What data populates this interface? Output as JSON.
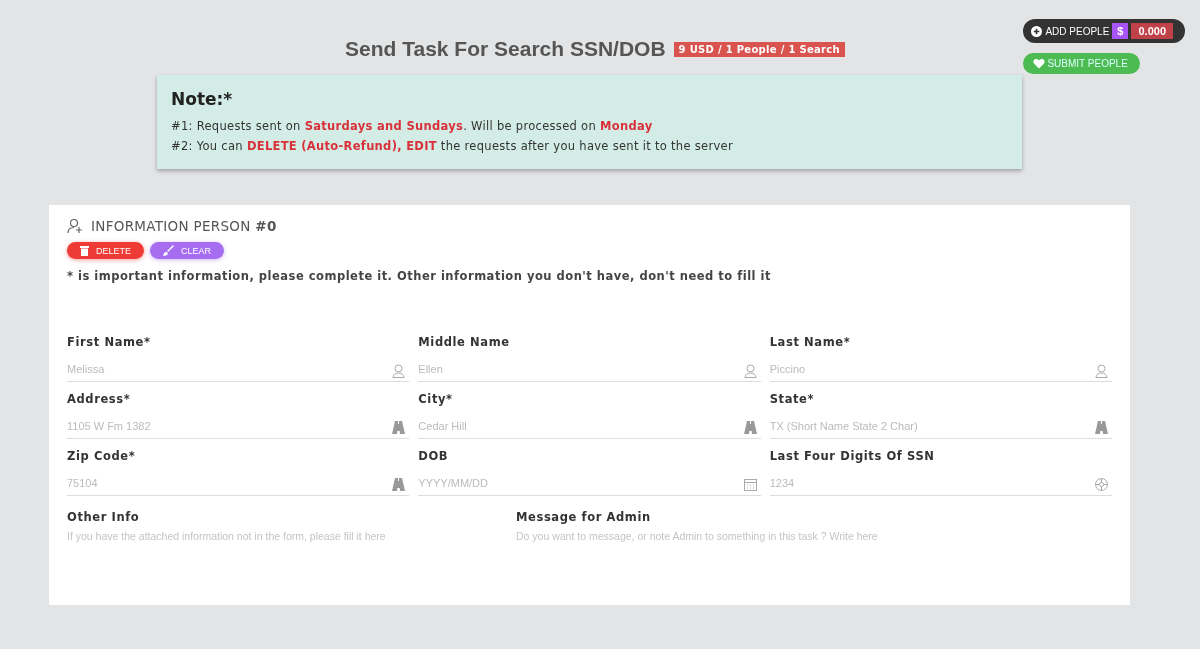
{
  "header": {
    "title": "Send Task For Search SSN/DOB",
    "price_badge": "9 USD / 1 People / 1 Search"
  },
  "actions": {
    "add_people": "ADD PEOPLE",
    "currency": "$",
    "balance": "0.000",
    "submit": "SUBMIT PEOPLE"
  },
  "note": {
    "title": "Note:*",
    "lines": [
      "#1: Requests sent on **Saturdays and Sundays**. Will be processed on **Monday**",
      "#2: You can **DELETE (Auto-Refund), EDIT** the requests after you have sent it to the server"
    ]
  },
  "person": {
    "title": "INFORMATION PERSON",
    "number": "#0",
    "delete": "DELETE",
    "clear": "CLEAR",
    "hint": "* is important information, please complete it. Other information you don't have, don't need to fill it",
    "fields": [
      {
        "label": "First Name*",
        "placeholder": "Melissa",
        "kind": "name"
      },
      {
        "label": "Middle Name",
        "placeholder": "Ellen",
        "kind": "name"
      },
      {
        "label": "Last Name*",
        "placeholder": "Piccino",
        "kind": "name"
      },
      {
        "label": "Address*",
        "placeholder": "1105 W Fm 1382",
        "kind": "place"
      },
      {
        "label": "City*",
        "placeholder": "Cedar Hill",
        "kind": "place"
      },
      {
        "label": "State*",
        "placeholder": "TX (Short Name State 2 Char)",
        "kind": "place"
      },
      {
        "label": "Zip Code*",
        "placeholder": "75104",
        "kind": "place"
      },
      {
        "label": "DOB",
        "placeholder": "YYYY/MM/DD",
        "kind": "date"
      },
      {
        "label": "Last Four Digits Of SSN",
        "placeholder": "1234",
        "kind": "number"
      }
    ],
    "notes": [
      {
        "label": "Other Info",
        "placeholder": "If you have the attached information not in the form, please fill it here"
      },
      {
        "label": "Message for Admin",
        "placeholder": "Do you want to message, or note Admin to something in this task ? Write here"
      }
    ]
  }
}
